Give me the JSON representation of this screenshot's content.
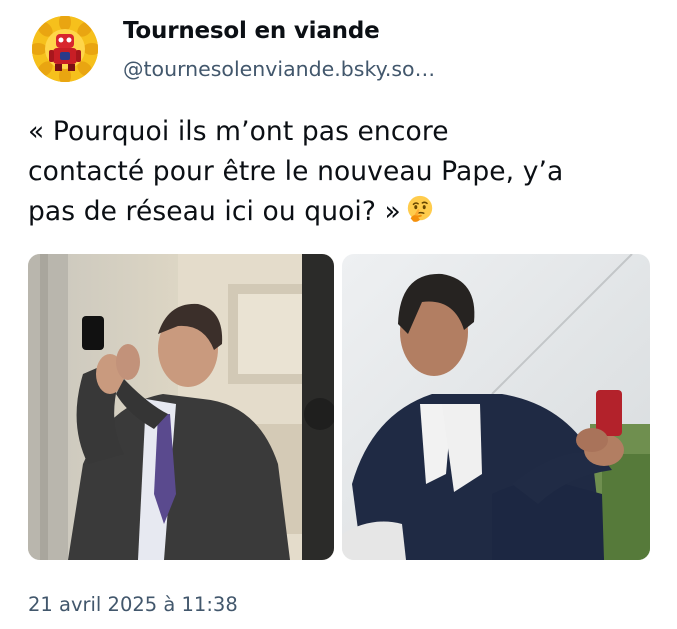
{
  "author": {
    "display_name": "Tournesol en viande",
    "handle": "@tournesolenviande.bsky.so…",
    "avatar_icon": "sunflower-robot-avatar"
  },
  "post": {
    "text_lines": [
      "« Pourquoi ils m’ont pas encore",
      "contacté pour être le nouveau Pape, y’a",
      "pas de réseau ici ou quoi? »"
    ],
    "emoji": "thinking-face-icon",
    "images": [
      {
        "name": "photo-man-phone-raised-street"
      },
      {
        "name": "photo-man-phone-seated-outdoor"
      }
    ],
    "timestamp": "21 avril 2025 à 11:38"
  },
  "colors": {
    "text": "#0b0f14",
    "muted": "#42576c",
    "background": "#ffffff"
  }
}
